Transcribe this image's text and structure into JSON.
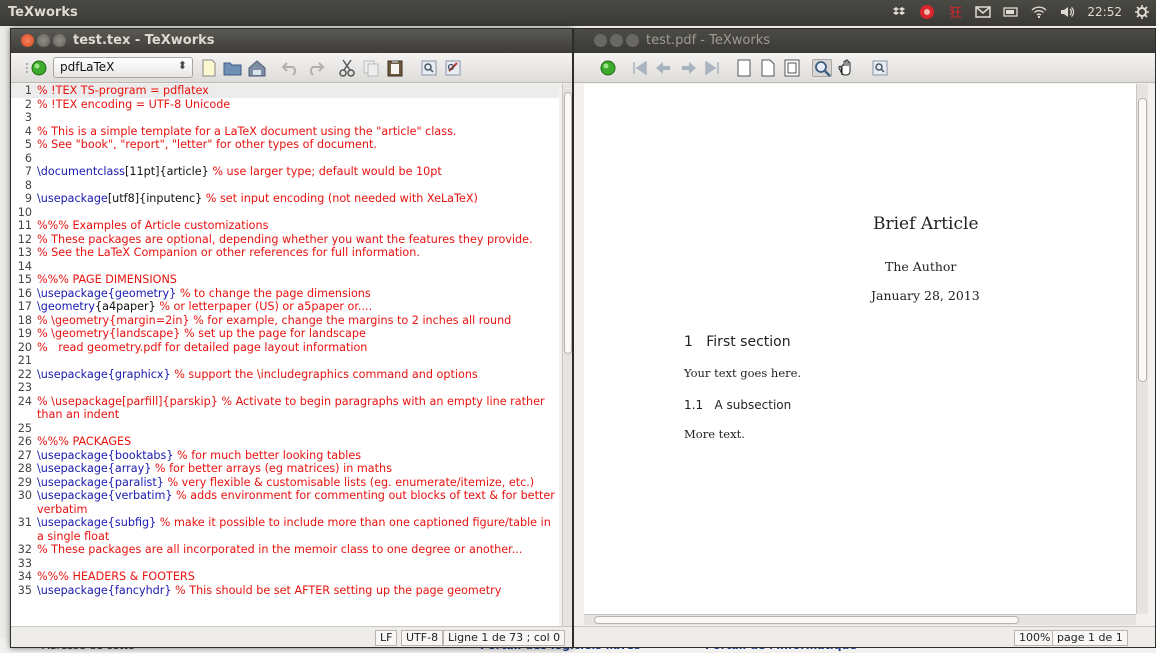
{
  "top_panel": {
    "app_title": "TeXworks",
    "clock": "22:52"
  },
  "editor": {
    "title": "test.tex - TeXworks",
    "engine": "pdfLaTeX",
    "status": {
      "line_ending": "LF",
      "encoding": "UTF-8",
      "position": "Ligne 1 de 73 ; col 0"
    },
    "lines": [
      {
        "n": "1",
        "segs": [
          {
            "c": "r",
            "t": "% !TEX TS-program = pdflatex"
          }
        ]
      },
      {
        "n": "2",
        "segs": [
          {
            "c": "r",
            "t": "% !TEX encoding = UTF-8 Unicode"
          }
        ]
      },
      {
        "n": "3",
        "segs": []
      },
      {
        "n": "4",
        "segs": [
          {
            "c": "r",
            "t": "% This is a simple template for a LaTeX document using the \"article\" class."
          }
        ]
      },
      {
        "n": "5",
        "segs": [
          {
            "c": "r",
            "t": "% See \"book\", \"report\", \"letter\" for other types of document."
          }
        ]
      },
      {
        "n": "6",
        "segs": []
      },
      {
        "n": "7",
        "segs": [
          {
            "c": "b",
            "t": "\\documentclass"
          },
          {
            "c": "k",
            "t": "[11pt]{article}"
          },
          {
            "c": "r",
            "t": " % use larger type; default would be 10pt"
          }
        ]
      },
      {
        "n": "8",
        "segs": []
      },
      {
        "n": "9",
        "segs": [
          {
            "c": "b",
            "t": "\\usepackage"
          },
          {
            "c": "k",
            "t": "[utf8]{inputenc}"
          },
          {
            "c": "r",
            "t": " % set input encoding (not needed with XeLaTeX)"
          }
        ]
      },
      {
        "n": "10",
        "segs": []
      },
      {
        "n": "11",
        "segs": [
          {
            "c": "r",
            "t": "%%% Examples of Article customizations"
          }
        ]
      },
      {
        "n": "12",
        "segs": [
          {
            "c": "r",
            "t": "% These packages are optional, depending whether you want the features they provide."
          }
        ]
      },
      {
        "n": "13",
        "segs": [
          {
            "c": "r",
            "t": "% See the LaTeX Companion or other references for full information."
          }
        ]
      },
      {
        "n": "14",
        "segs": []
      },
      {
        "n": "15",
        "segs": [
          {
            "c": "r",
            "t": "%%% PAGE DIMENSIONS"
          }
        ]
      },
      {
        "n": "16",
        "segs": [
          {
            "c": "b",
            "t": "\\usepackage{geometry}"
          },
          {
            "c": "r",
            "t": " % to change the page dimensions"
          }
        ]
      },
      {
        "n": "17",
        "segs": [
          {
            "c": "b",
            "t": "\\geometry"
          },
          {
            "c": "k",
            "t": "{a4paper}"
          },
          {
            "c": "r",
            "t": " % or letterpaper (US) or a5paper or...."
          }
        ]
      },
      {
        "n": "18",
        "segs": [
          {
            "c": "r",
            "t": "% \\geometry{margin=2in} % for example, change the margins to 2 inches all round"
          }
        ]
      },
      {
        "n": "19",
        "segs": [
          {
            "c": "r",
            "t": "% \\geometry{landscape} % set up the page for landscape"
          }
        ]
      },
      {
        "n": "20",
        "segs": [
          {
            "c": "r",
            "t": "%   read geometry.pdf for detailed page layout information"
          }
        ]
      },
      {
        "n": "21",
        "segs": []
      },
      {
        "n": "22",
        "segs": [
          {
            "c": "b",
            "t": "\\usepackage{graphicx}"
          },
          {
            "c": "r",
            "t": " % support the \\includegraphics command and options"
          }
        ]
      },
      {
        "n": "23",
        "segs": []
      },
      {
        "n": "24",
        "wrap": true,
        "segs": [
          {
            "c": "r",
            "t": "% \\usepackage[parfill]{parskip} % Activate to begin paragraphs with an empty line rather than an indent"
          }
        ]
      },
      {
        "n": "25",
        "segs": []
      },
      {
        "n": "26",
        "segs": [
          {
            "c": "r",
            "t": "%%% PACKAGES"
          }
        ]
      },
      {
        "n": "27",
        "segs": [
          {
            "c": "b",
            "t": "\\usepackage{booktabs}"
          },
          {
            "c": "r",
            "t": " % for much better looking tables"
          }
        ]
      },
      {
        "n": "28",
        "segs": [
          {
            "c": "b",
            "t": "\\usepackage{array}"
          },
          {
            "c": "r",
            "t": " % for better arrays (eg matrices) in maths"
          }
        ]
      },
      {
        "n": "29",
        "segs": [
          {
            "c": "b",
            "t": "\\usepackage{paralist}"
          },
          {
            "c": "r",
            "t": " % very flexible & customisable lists (eg. enumerate/itemize, etc.)"
          }
        ]
      },
      {
        "n": "30",
        "wrap": true,
        "segs": [
          {
            "c": "b",
            "t": "\\usepackage{verbatim}"
          },
          {
            "c": "r",
            "t": " % adds environment for commenting out blocks of text & for better verbatim"
          }
        ]
      },
      {
        "n": "31",
        "wrap": true,
        "segs": [
          {
            "c": "b",
            "t": "\\usepackage{subfig}"
          },
          {
            "c": "r",
            "t": " % make it possible to include more than one captioned figure/table in a single float"
          }
        ]
      },
      {
        "n": "32",
        "segs": [
          {
            "c": "r",
            "t": "% These packages are all incorporated in the memoir class to one degree or another..."
          }
        ]
      },
      {
        "n": "33",
        "segs": []
      },
      {
        "n": "34",
        "segs": [
          {
            "c": "r",
            "t": "%%% HEADERS & FOOTERS"
          }
        ]
      },
      {
        "n": "35",
        "segs": [
          {
            "c": "b",
            "t": "\\usepackage{fancyhdr}"
          },
          {
            "c": "r",
            "t": " % This should be set AFTER setting up the page geometry"
          }
        ]
      }
    ]
  },
  "pdf": {
    "title": "test.pdf - TeXworks",
    "doc_title": "Brief Article",
    "author": "The Author",
    "date": "January 28, 2013",
    "section": "1   First section",
    "section_text": "Your text goes here.",
    "subsection": "1.1   A subsection",
    "subsection_text": "More text.",
    "zoom": "100%",
    "page": "page 1 de 1"
  },
  "background": {
    "bottom_left": "Adresse de cette",
    "bottom_mid": "Portail des logiciels libres",
    "bottom_right": "Portail de l'informatique",
    "strip": [
      "ys",
      "sl",
      "",
      "ys",
      "su",
      "pr",
      "ir",
      "ne",
      "",
      "",
      "Te",
      "",
      "",
      "",
      "(A"
    ]
  },
  "colors": {
    "comment": "#e8120f",
    "command": "#1a1ab0",
    "panel": "#3c3b37"
  }
}
